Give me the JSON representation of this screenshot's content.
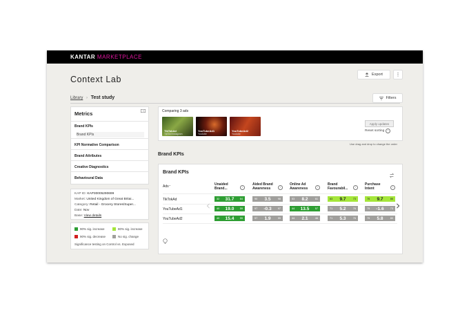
{
  "header": {
    "brand_primary": "KANTAR",
    "brand_secondary": "MARKETPLACE",
    "page_title": "Context Lab",
    "export_label": "Export",
    "more_label": "⋮"
  },
  "breadcrumb": {
    "library": "Library",
    "separator": "›",
    "current": "Test study"
  },
  "filters_label": "Filters",
  "metrics_panel": {
    "title": "Metrics",
    "items": [
      {
        "label": "Brand KPIs",
        "sub": "Brand KPIs"
      },
      {
        "label": "KPI Normative Comparison"
      },
      {
        "label": "Brand Attributes"
      },
      {
        "label": "Creative Diagnostics"
      },
      {
        "label": "Behavioural Data"
      }
    ]
  },
  "info_panel": {
    "kap_label": "KAP ID:",
    "kap_value": "KAP30005290699",
    "market_label": "Market:",
    "market_value": "United Kingdom of Great Britai...",
    "category_label": "Category:",
    "category_value": "Retail - Grocery Stores/Super...",
    "date_label": "Date:",
    "date_value": "Nov",
    "base_label": "Base:",
    "base_value": "View details"
  },
  "legend": {
    "items": [
      "90% sig. increase",
      "80% sig. increase",
      "90% sig. decrease",
      "No sig. change"
    ],
    "note": "Significance testing on Control vs. Exposed"
  },
  "compare": {
    "title": "Comparing 3 ads",
    "ads": [
      {
        "name": "TikTokAd",
        "platform": "TikTok/Instagram"
      },
      {
        "name": "YouTubeAd1",
        "platform": "Youtube"
      },
      {
        "name": "YouTubeAd2",
        "platform": "Youtube"
      }
    ],
    "apply_label": "Apply updates",
    "reset_label": "Reset sorting",
    "drag_hint": "Use drag and drop to change the order"
  },
  "section_title": "Brand KPIs",
  "kpi_table": {
    "title": "Brand KPIs",
    "ads_header": "Ads",
    "columns": [
      {
        "l1": "Unaided",
        "l2": "Brand..."
      },
      {
        "l1": "Aided Brand",
        "l2": "Awareness"
      },
      {
        "l1": "Online Ad",
        "l2": "Awareness"
      },
      {
        "l1": "Brand",
        "l2": "Favourabil..."
      },
      {
        "l1": "Purchase",
        "l2": "Intent"
      }
    ],
    "rows": [
      {
        "name": "TikTokAd",
        "cells": [
          {
            "left": "32",
            "value": "31.7",
            "right": "64",
            "status": "green"
          },
          {
            "left": "90",
            "value": "3.5",
            "right": "98",
            "status": "grey"
          },
          {
            "left": "53",
            "value": "8.2",
            "right": "61",
            "status": "grey"
          },
          {
            "left": "63",
            "value": "9.7",
            "right": "73",
            "status": "lime"
          },
          {
            "left": "76",
            "value": "9.7",
            "right": "86",
            "status": "lime"
          }
        ]
      },
      {
        "name": "YouTubeAd1",
        "cells": [
          {
            "left": "40",
            "value": "19.0",
            "right": "59",
            "status": "green"
          },
          {
            "left": "97",
            "value": "-0.3",
            "right": "97",
            "status": "grey"
          },
          {
            "left": "44",
            "value": "13.5",
            "right": "57",
            "status": "green"
          },
          {
            "left": "71",
            "value": "5.2",
            "right": "76",
            "status": "grey"
          },
          {
            "left": "75",
            "value": "-1.6",
            "right": "73",
            "status": "grey"
          }
        ]
      },
      {
        "name": "YouTubeAd2",
        "cells": [
          {
            "left": "40",
            "value": "15.4",
            "right": "55",
            "status": "green"
          },
          {
            "left": "97",
            "value": "1.9",
            "right": "99",
            "status": "grey"
          },
          {
            "left": "44",
            "value": "2.1",
            "right": "46",
            "status": "grey"
          },
          {
            "left": "71",
            "value": "5.3",
            "right": "76",
            "status": "grey"
          },
          {
            "left": "75",
            "value": "5.8",
            "right": "80",
            "status": "grey"
          }
        ]
      }
    ]
  },
  "colors": {
    "green": "#2e9e33",
    "lime": "#a5e63a",
    "red": "#d21f1f",
    "grey": "#a09f9c",
    "accent": "#e0169f"
  }
}
